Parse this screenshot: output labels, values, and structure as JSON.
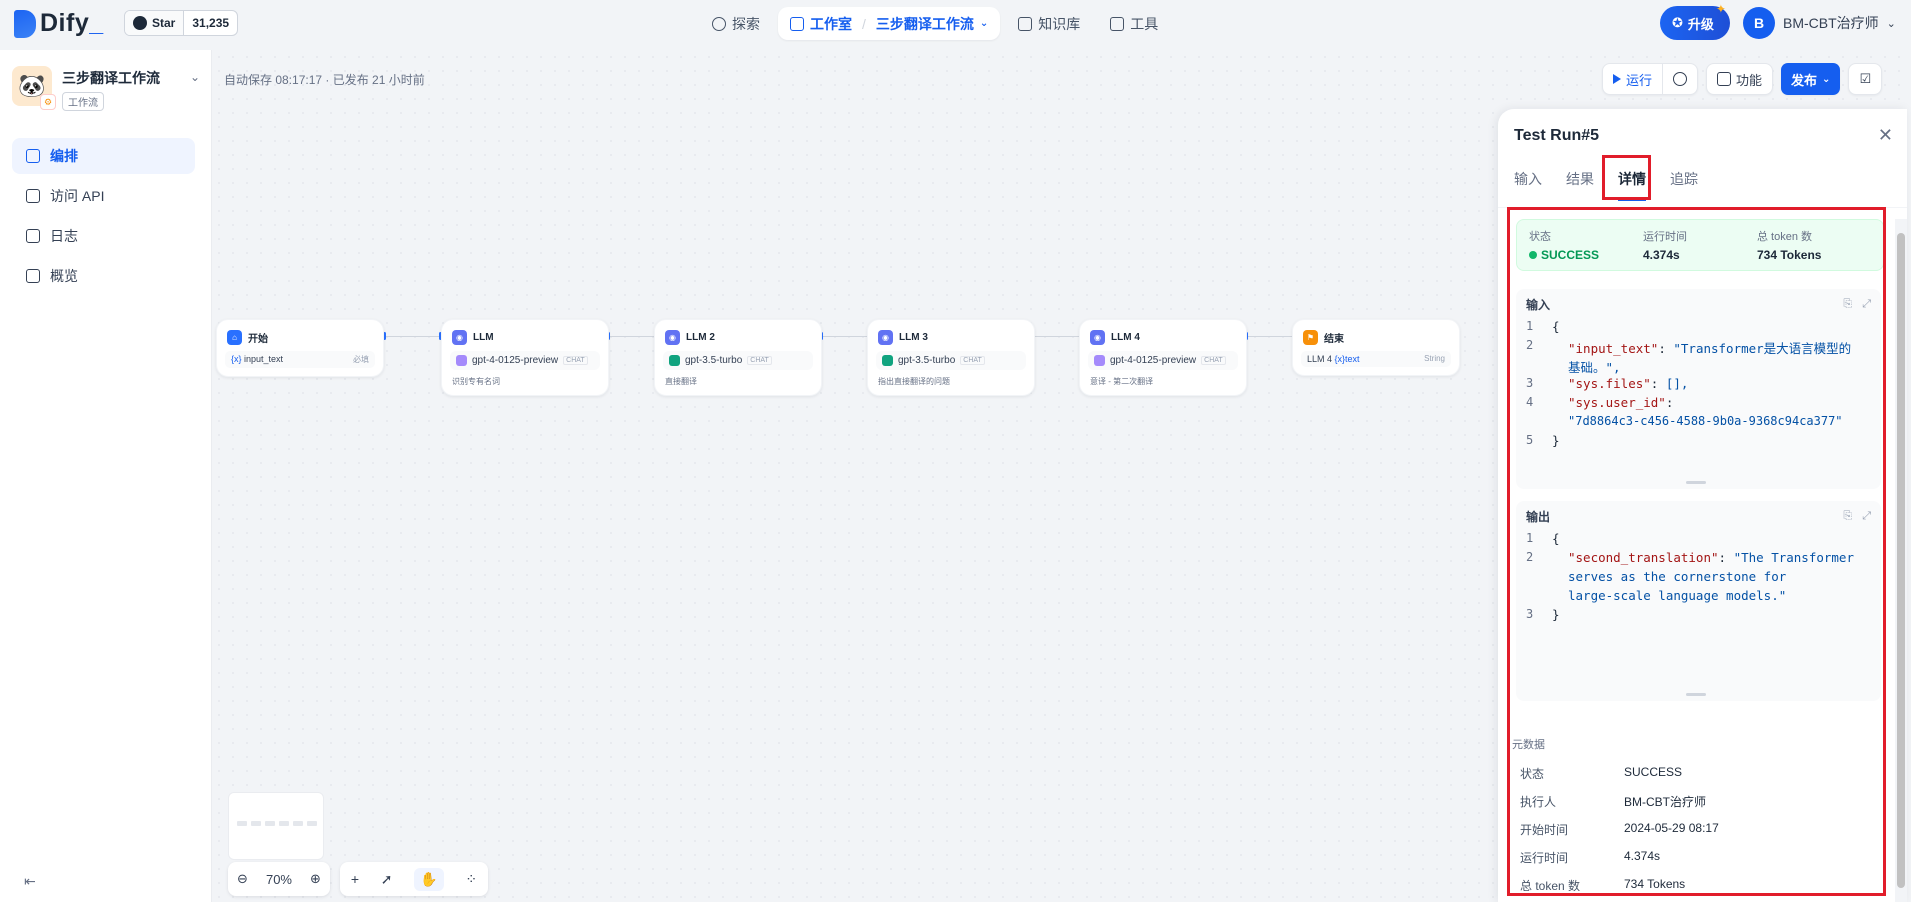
{
  "topnav": {
    "brand": "Dify",
    "github_star_label": "Star",
    "github_star_count": "31,235",
    "nav": {
      "explore": "探索",
      "studio": "工作室",
      "current_app": "三步翻译工作流",
      "knowledge": "知识库",
      "tools": "工具"
    },
    "upgrade_label": "升级",
    "user_initial": "B",
    "user_name": "BM-CBT治疗师"
  },
  "sidebar": {
    "app_name": "三步翻译工作流",
    "app_type": "工作流",
    "items": [
      {
        "label": "编排",
        "icon": "workflow-icon",
        "active": true
      },
      {
        "label": "访问 API",
        "icon": "terminal-icon",
        "active": false
      },
      {
        "label": "日志",
        "icon": "log-icon",
        "active": false
      },
      {
        "label": "概览",
        "icon": "chart-icon",
        "active": false
      }
    ]
  },
  "canvas": {
    "autosave": "自动保存 08:17:17 · 已发布 21 小时前",
    "toolbar": {
      "run_label": "运行",
      "features_label": "功能",
      "publish_label": "发布"
    },
    "zoom_level": "70%",
    "nodes": [
      {
        "title": "开始",
        "var_name": "input_text",
        "var_required": "必填"
      },
      {
        "title": "LLM",
        "model": "gpt-4-0125-preview",
        "mode": "CHAT",
        "desc": "识别专有名词"
      },
      {
        "title": "LLM 2",
        "model": "gpt-3.5-turbo",
        "mode": "CHAT",
        "desc": "直接翻译"
      },
      {
        "title": "LLM 3",
        "model": "gpt-3.5-turbo",
        "mode": "CHAT",
        "desc": "指出直接翻译的问题"
      },
      {
        "title": "LLM 4",
        "model": "gpt-4-0125-preview",
        "mode": "CHAT",
        "desc": "意译 - 第二次翻译"
      },
      {
        "title": "结束",
        "var_source": "LLM 4",
        "var_name": "text",
        "var_type": "String"
      }
    ]
  },
  "panel": {
    "title": "Test Run#5",
    "tabs": [
      "输入",
      "结果",
      "详情",
      "追踪"
    ],
    "active_tab": "详情",
    "status": {
      "status_label": "状态",
      "status_value": "SUCCESS",
      "time_label": "运行时间",
      "time_value": "4.374s",
      "tokens_label": "总 token 数",
      "tokens_value": "734 Tokens"
    },
    "input_box": {
      "title": "输入",
      "lines": [
        {
          "n": "1",
          "open": "{"
        },
        {
          "n": "2",
          "key": "\"input_text\"",
          "val": "\"Transformer是大语言模型的",
          "val2": "基础。\","
        },
        {
          "n": "3",
          "key": "\"sys.files\"",
          "val": "[],"
        },
        {
          "n": "4",
          "key": "\"sys.user_id\"",
          "val": "\"7d8864c3-c456-4588-9b0a-9368c94ca377\""
        },
        {
          "n": "5",
          "open": "}"
        }
      ]
    },
    "output_box": {
      "title": "输出",
      "lines": [
        {
          "n": "1",
          "open": "{"
        },
        {
          "n": "2",
          "key": "\"second_translation\"",
          "val": "\"The Transformer",
          "val2": "serves as the cornerstone for",
          "val3": "large-scale language models.\""
        },
        {
          "n": "3",
          "open": "}"
        }
      ]
    },
    "metadata": {
      "title": "元数据",
      "rows": [
        {
          "k": "状态",
          "v": "SUCCESS"
        },
        {
          "k": "执行人",
          "v": "BM-CBT治疗师"
        },
        {
          "k": "开始时间",
          "v": "2024-05-29 08:17"
        },
        {
          "k": "运行时间",
          "v": "4.374s"
        },
        {
          "k": "总 token 数",
          "v": "734 Tokens"
        }
      ]
    }
  },
  "colors": {
    "accent": "#155eef",
    "success": "#12b76a",
    "highlight": "#e11d2a"
  }
}
